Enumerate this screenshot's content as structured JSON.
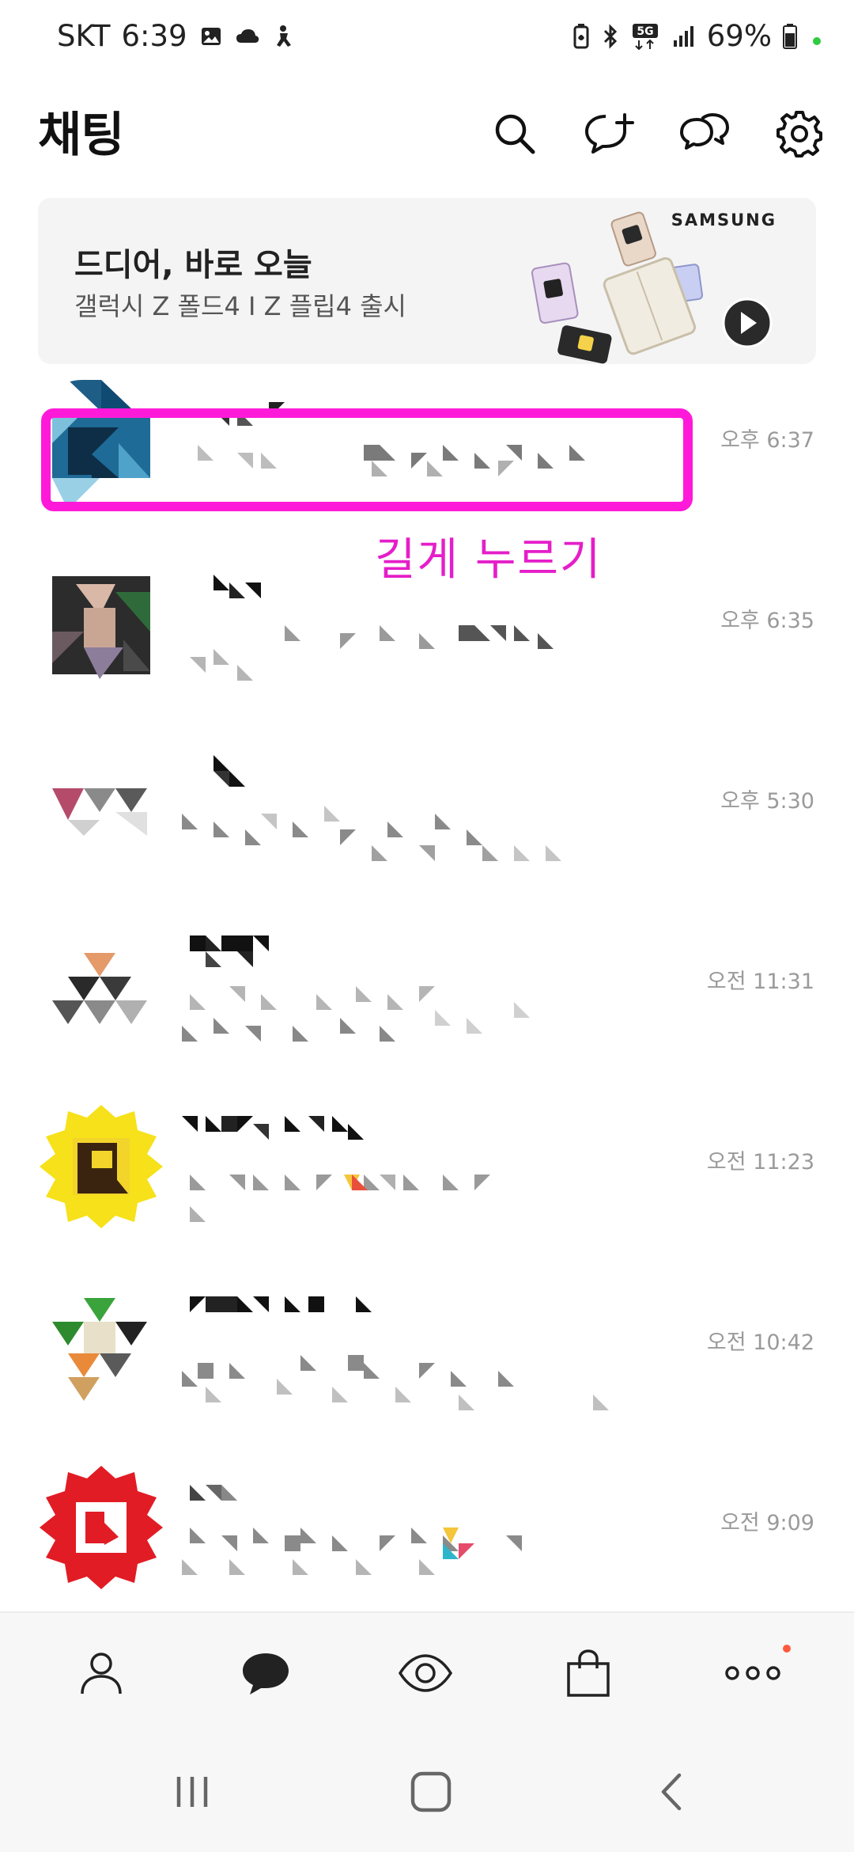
{
  "status_bar": {
    "carrier": "SKT",
    "time": "6:39",
    "network": "5G",
    "battery": "69%",
    "left_icons": [
      "gallery-icon",
      "cloud-icon",
      "accessibility-icon"
    ],
    "right_icons": [
      "battery-saver-icon",
      "bluetooth-icon",
      "5g-icon",
      "signal-icon",
      "battery-icon"
    ]
  },
  "header": {
    "title": "채팅",
    "actions": [
      {
        "name": "search-button",
        "icon": "search-icon"
      },
      {
        "name": "new-chat-button",
        "icon": "chat-plus-icon"
      },
      {
        "name": "open-chat-button",
        "icon": "open-chat-icon"
      },
      {
        "name": "settings-button",
        "icon": "gear-icon"
      }
    ]
  },
  "banner": {
    "title": "드디어, 바로 오늘",
    "subtitle": "갤럭시 Z 폴드4 I Z 플립4 출시",
    "brand": "SAMSUNG"
  },
  "chats": [
    {
      "time": "오후 6:37"
    },
    {
      "time": "오후 6:35"
    },
    {
      "time": "오후 5:30"
    },
    {
      "time": "오전 11:31"
    },
    {
      "time": "오전 11:23"
    },
    {
      "time": "오전 10:42"
    },
    {
      "time": "오전 9:09"
    }
  ],
  "annotation": {
    "label": "길게 누르기",
    "color": "#ff1ad9"
  },
  "bottom_nav": [
    {
      "name": "nav-friends",
      "icon": "person-icon"
    },
    {
      "name": "nav-chats",
      "icon": "chat-bubble-icon"
    },
    {
      "name": "nav-view",
      "icon": "eye-icon"
    },
    {
      "name": "nav-shopping",
      "icon": "shopping-bag-icon"
    },
    {
      "name": "nav-more",
      "icon": "more-dots-icon"
    }
  ],
  "colors": {
    "accent": "#ff1ad9",
    "badge": "#ff5a3c",
    "online_dot": "#2ecc40"
  }
}
